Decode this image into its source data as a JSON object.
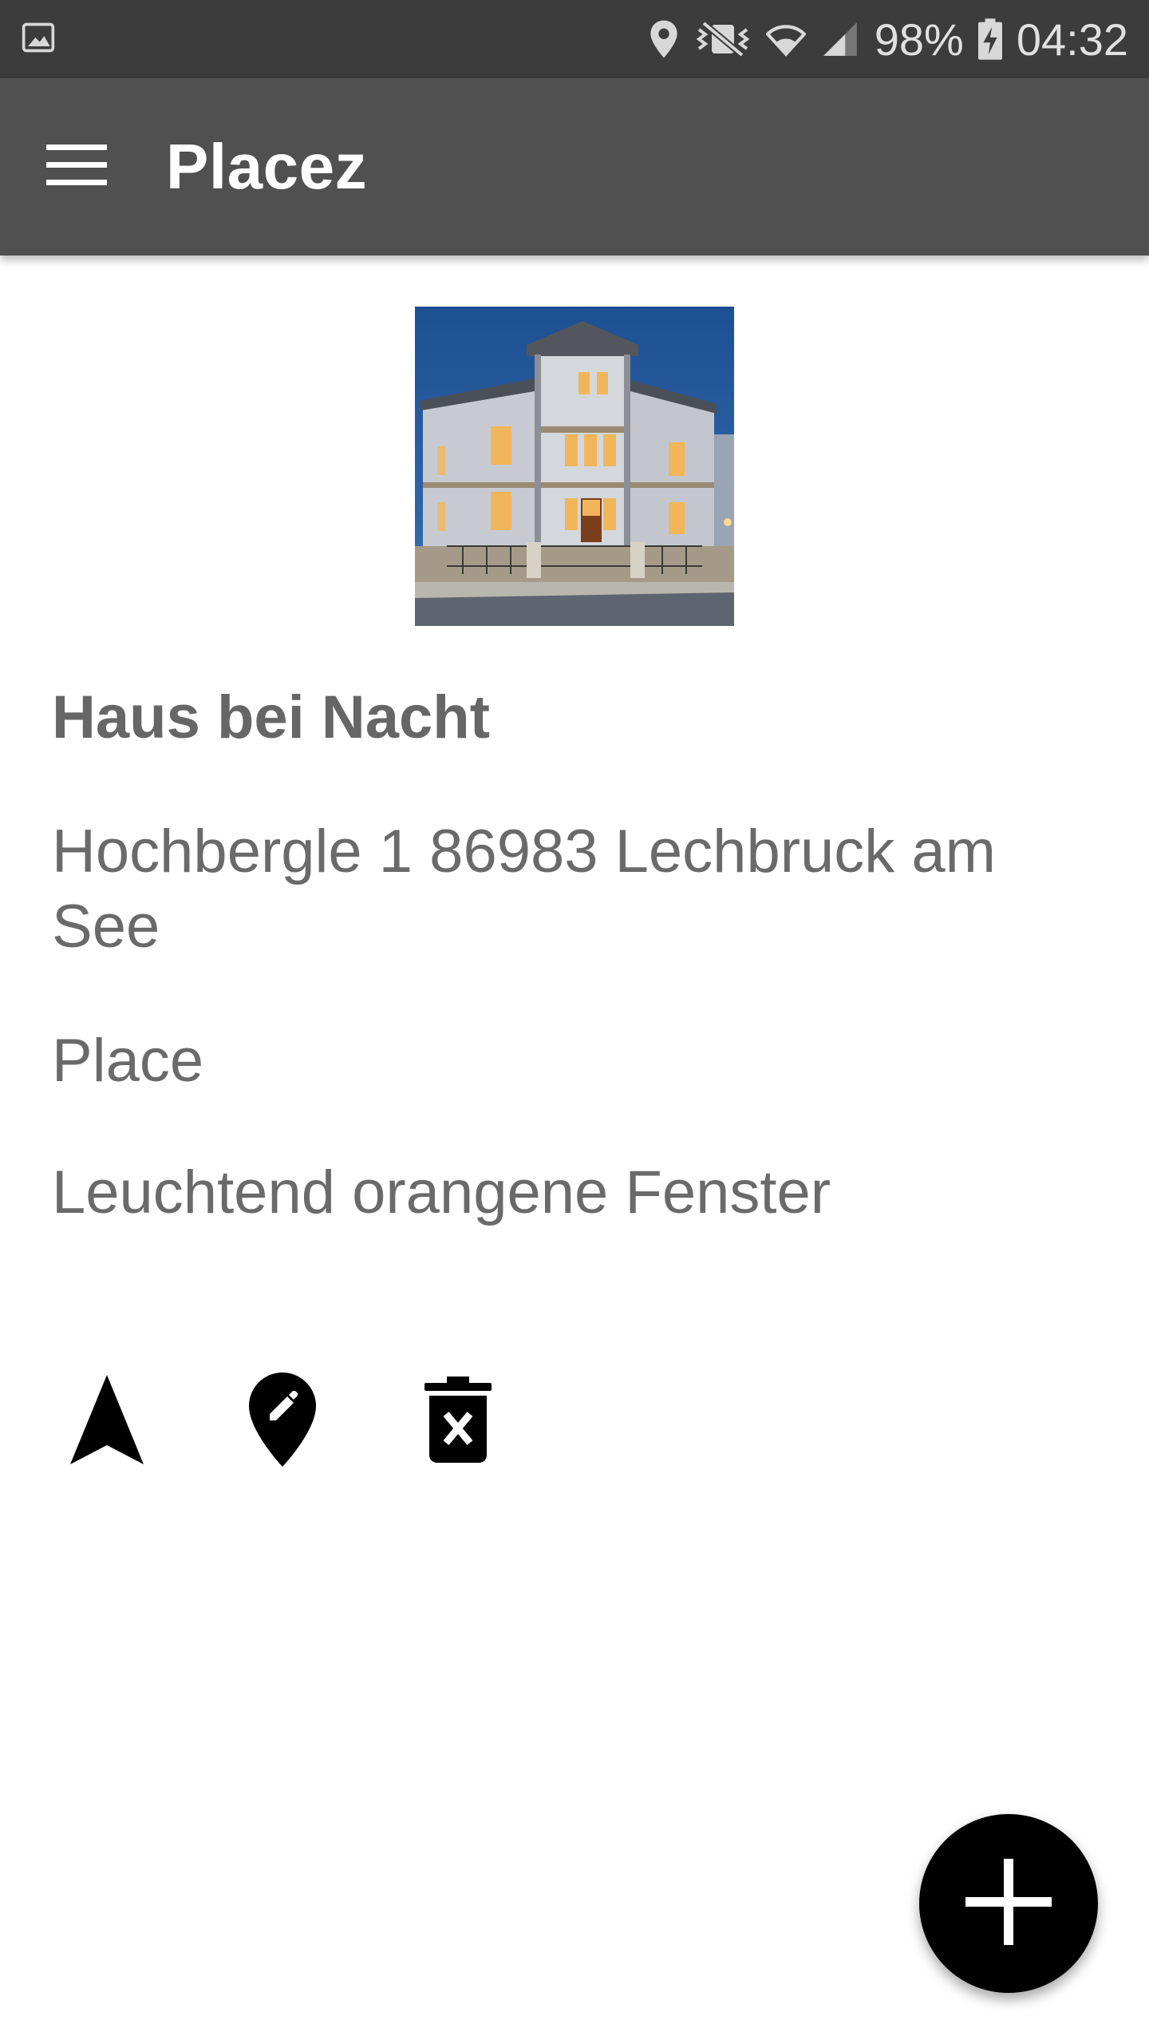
{
  "status_bar": {
    "battery": "98%",
    "time": "04:32",
    "icons": [
      "gallery-icon",
      "location-icon",
      "mute-vibrate-icon",
      "wifi-icon",
      "signal-icon",
      "battery-charging-icon"
    ]
  },
  "app_bar": {
    "title": "Placez",
    "menu_icon": "hamburger-menu-icon"
  },
  "place": {
    "name": "Haus bei Nacht",
    "address": "Hochbergle 1 86983 Lechbruck am See",
    "type": "Place",
    "description": "Leuchtend orangene Fenster"
  },
  "actions": {
    "navigate_icon": "navigation-arrow-icon",
    "edit_icon": "edit-location-icon",
    "delete_icon": "delete-forever-icon"
  },
  "fab": {
    "icon": "plus-icon"
  },
  "colors": {
    "status_bar_bg": "#3c3c3c",
    "app_bar_bg": "#505050",
    "text_gray": "#6a6a6a",
    "fab_bg": "#000000"
  }
}
